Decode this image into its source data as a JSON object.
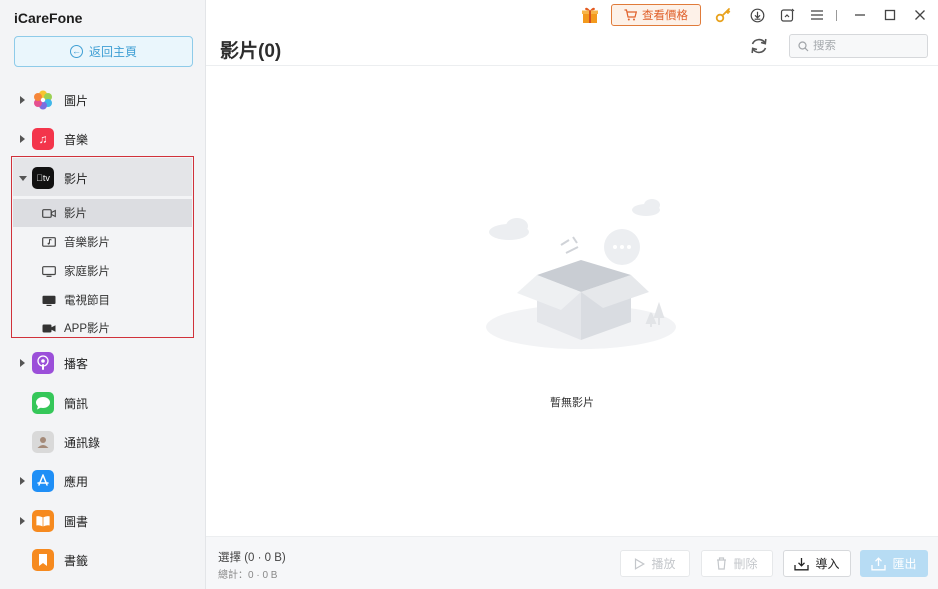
{
  "app": {
    "title": "iCareFone"
  },
  "sidebar": {
    "back_label": "返回主頁",
    "items": [
      {
        "label": "圖片",
        "icon": "photos-icon",
        "color": "#f2a23a"
      },
      {
        "label": "音樂",
        "icon": "music-icon",
        "color": "#f3354b"
      },
      {
        "label": "影片",
        "icon": "apple-tv-icon",
        "color": "#111111",
        "icon_text": "tv"
      },
      {
        "label": "播客",
        "icon": "podcast-icon",
        "color": "#9b4fd9"
      },
      {
        "label": "簡訊",
        "icon": "messages-icon",
        "color": "#35c759"
      },
      {
        "label": "通訊錄",
        "icon": "contacts-icon",
        "color": "#b9b9b9"
      },
      {
        "label": "應用",
        "icon": "app-store-icon",
        "color": "#1f8ff6"
      },
      {
        "label": "圖書",
        "icon": "books-icon",
        "color": "#f68a1f"
      },
      {
        "label": "書籤",
        "icon": "bookmarks-icon",
        "color": "#f68a1f"
      }
    ],
    "video_sub": [
      {
        "label": "影片",
        "icon": "video-camera-icon"
      },
      {
        "label": "音樂影片",
        "icon": "music-video-icon"
      },
      {
        "label": "家庭影片",
        "icon": "monitor-icon"
      },
      {
        "label": "電視節目",
        "icon": "tv-show-icon"
      },
      {
        "label": "APP影片",
        "icon": "app-video-icon"
      }
    ]
  },
  "topbar": {
    "price_label": "查看價格"
  },
  "main": {
    "title": "影片(0)",
    "search_placeholder": "搜索",
    "empty_text": "暫無影片"
  },
  "footer": {
    "selection": "選擇 (0 · 0 B)",
    "total": "總計：0 · 0 B",
    "play_label": "播放",
    "delete_label": "刪除",
    "import_label": "導入",
    "export_label": "匯出"
  },
  "colors": {
    "accent": "#3f9fd4",
    "highlight_border": "#d0313a",
    "price_orange": "#e0602a"
  }
}
